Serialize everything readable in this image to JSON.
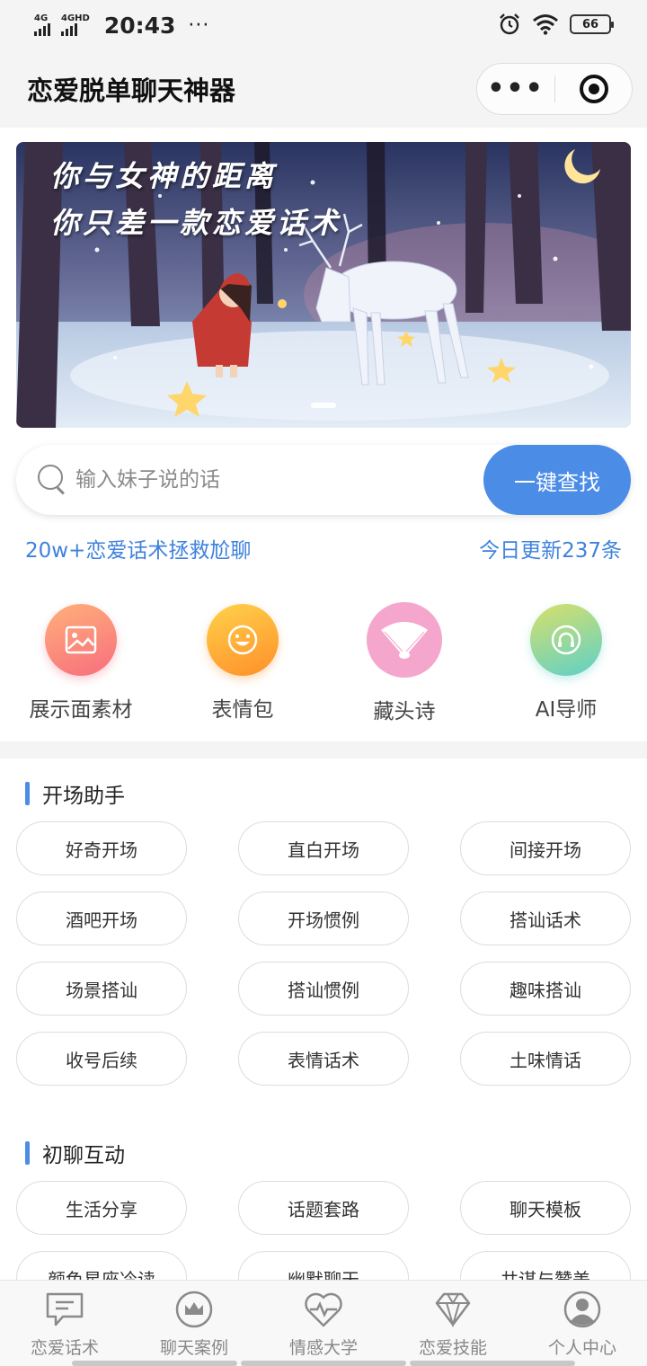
{
  "status": {
    "sim1": "4G",
    "sim2": "4GHD",
    "time": "20:43",
    "dots": "···",
    "battery": "66"
  },
  "header": {
    "title": "恋爱脱单聊天神器",
    "more_icon": "more-dots-icon",
    "close_icon": "target-circle-icon"
  },
  "banner": {
    "line1": "你与女神的距离",
    "line2": "你只差一款恋爱话术"
  },
  "search": {
    "placeholder": "输入妹子说的话",
    "button": "一键查找"
  },
  "tagline": {
    "left": "20w+恋爱话术拯救尬聊",
    "right": "今日更新237条"
  },
  "features": [
    {
      "label": "展示面素材",
      "icon": "image-icon"
    },
    {
      "label": "表情包",
      "icon": "smile-icon"
    },
    {
      "label": "藏头诗",
      "icon": "fan-icon"
    },
    {
      "label": "AI导师",
      "icon": "headset-icon"
    }
  ],
  "sections": [
    {
      "title": "开场助手",
      "chips": [
        "好奇开场",
        "直白开场",
        "间接开场",
        "酒吧开场",
        "开场惯例",
        "搭讪话术",
        "场景搭讪",
        "搭讪惯例",
        "趣味搭讪",
        "收号后续",
        "表情话术",
        "土味情话"
      ]
    },
    {
      "title": "初聊互动",
      "chips": [
        "生活分享",
        "话题套路",
        "聊天模板",
        "颜色星座冷读",
        "幽默聊天",
        "共谋与赞美"
      ]
    }
  ],
  "tabs": [
    {
      "label": "恋爱话术",
      "icon": "chat-bubble-icon"
    },
    {
      "label": "聊天案例",
      "icon": "crown-icon"
    },
    {
      "label": "情感大学",
      "icon": "heart-pulse-icon"
    },
    {
      "label": "恋爱技能",
      "icon": "diamond-icon"
    },
    {
      "label": "个人中心",
      "icon": "user-avatar-icon"
    }
  ],
  "colors": {
    "accent": "#4a8ce6",
    "tagline": "#3f82dc"
  }
}
